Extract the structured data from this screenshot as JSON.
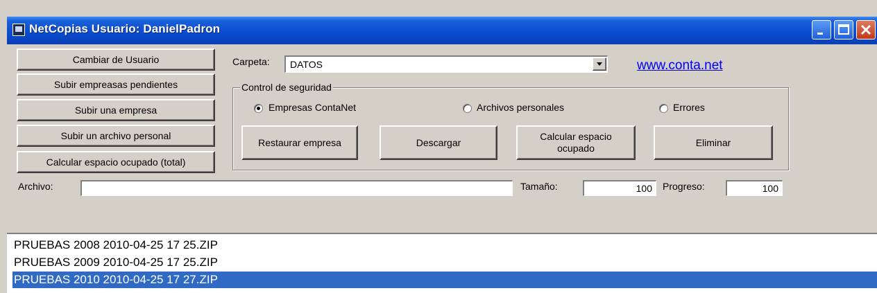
{
  "window": {
    "title": "NetCopias Usuario: DanielPadron"
  },
  "left_buttons": [
    {
      "label": "Cambiar de Usuario"
    },
    {
      "label": "Subir empreasas pendientes"
    },
    {
      "label": "Subir una empresa"
    },
    {
      "label": "Subir un archivo personal"
    },
    {
      "label": "Calcular espacio ocupado (total)"
    }
  ],
  "folder": {
    "label": "Carpeta:",
    "value": "DATOS"
  },
  "link": {
    "text": "www.conta.net"
  },
  "security": {
    "title": "Control de seguridad",
    "options": [
      {
        "label": "Empresas ContaNet",
        "selected": true
      },
      {
        "label": "Archivos personales",
        "selected": false
      },
      {
        "label": "Errores",
        "selected": false
      }
    ],
    "buttons": [
      {
        "label": "Restaurar empresa"
      },
      {
        "label": "Descargar"
      },
      {
        "label": "Calcular espacio ocupado"
      },
      {
        "label": "Eliminar"
      }
    ]
  },
  "file": {
    "label": "Archivo:",
    "value": ""
  },
  "size": {
    "label": "Tamaño:",
    "value": "100"
  },
  "progress": {
    "label": "Progreso:",
    "value": "100"
  },
  "files": [
    {
      "name": "PRUEBAS 2008 2010-04-25  17 25.ZIP",
      "selected": false
    },
    {
      "name": "PRUEBAS 2009 2010-04-25  17 25.ZIP",
      "selected": false
    },
    {
      "name": "PRUEBAS 2010 2010-04-25  17 27.ZIP",
      "selected": true
    }
  ]
}
